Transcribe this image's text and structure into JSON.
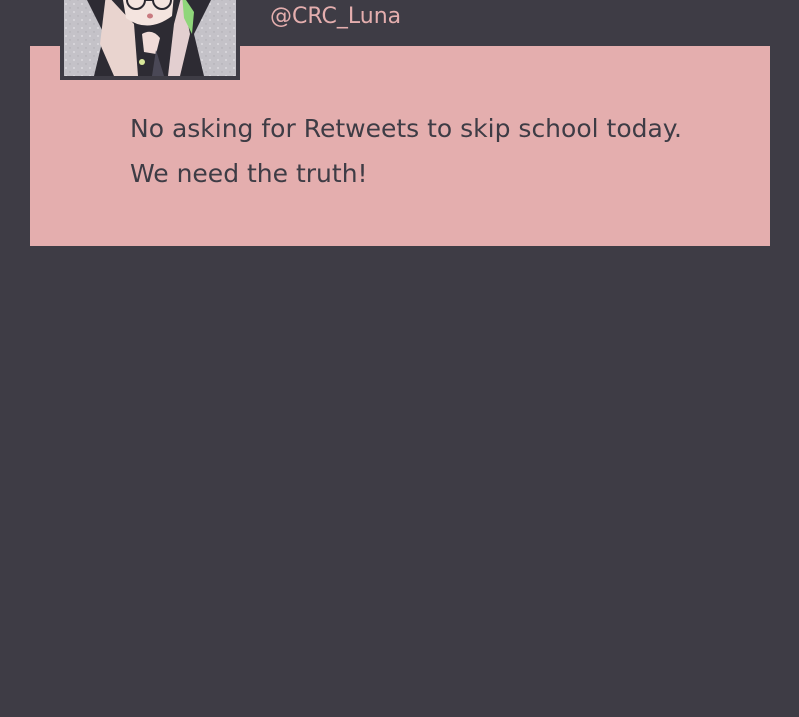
{
  "post": {
    "handle": "@CRC_Luna",
    "text_lines": [
      "No asking for Retweets to skip school today.",
      "We need the truth!"
    ]
  },
  "avatar": {
    "icon": "character-avatar-icon",
    "description_colors": {
      "background": "#c9c7cc",
      "hair": "#e9d4cf",
      "hood": "#2d2b33",
      "accent": "#8fd67a"
    }
  },
  "colors": {
    "page_background": "#3e3c45",
    "card_background": "#e4aeae",
    "text_dark": "#3e3c45",
    "handle_pink": "#e4aeae"
  }
}
